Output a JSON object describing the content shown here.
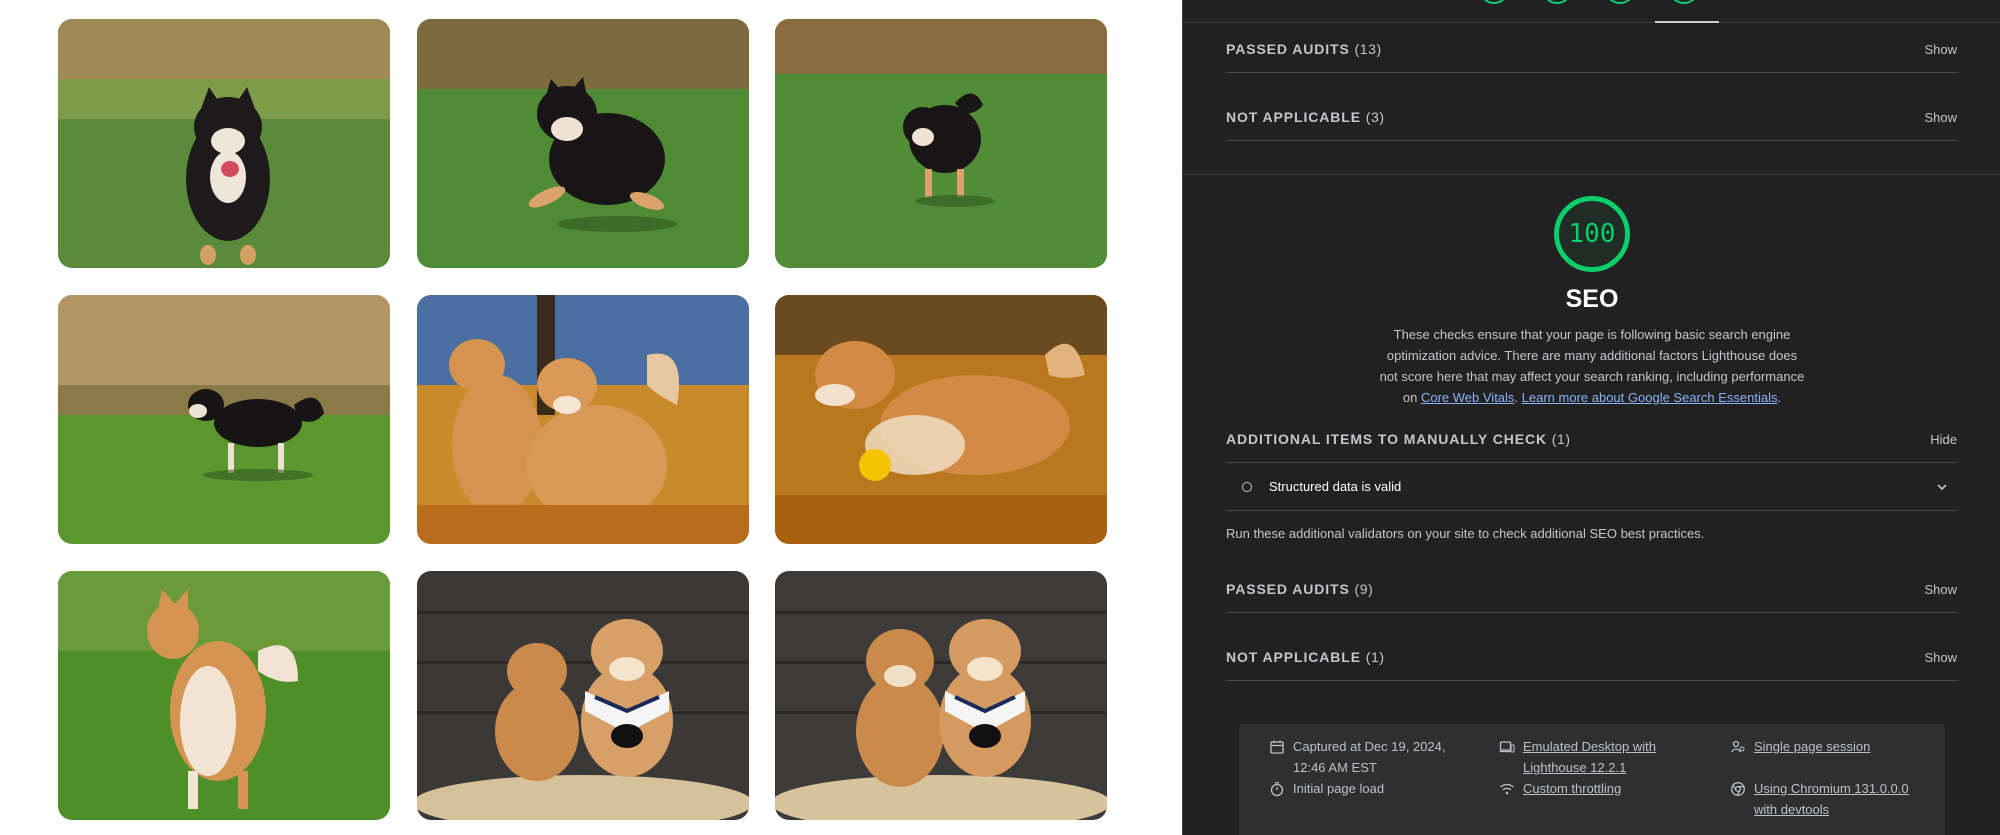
{
  "gallery": {
    "photos": [
      {
        "alt": "black shiba running"
      },
      {
        "alt": "black shiba jumping"
      },
      {
        "alt": "black shiba trotting"
      },
      {
        "alt": "black shiba standing"
      },
      {
        "alt": "two red shibas in leaves"
      },
      {
        "alt": "red shiba walking in leaves"
      },
      {
        "alt": "cream shiba standing"
      },
      {
        "alt": "two shiba puppies"
      },
      {
        "alt": "two shiba puppies with bandana"
      }
    ]
  },
  "panel": {
    "upper_groups": [
      {
        "title": "PASSED AUDITS",
        "count": "(13)",
        "toggle": "Show"
      },
      {
        "title": "NOT APPLICABLE",
        "count": "(3)",
        "toggle": "Show"
      }
    ],
    "seo": {
      "score": "100",
      "title": "SEO",
      "description_before": "These checks ensure that your page is following basic search engine optimization advice. There are many additional factors Lighthouse does not score here that may affect your search ranking, including performance on ",
      "link_core_web_vitals": "Core Web Vitals",
      "description_mid": ". ",
      "link_learn_more": "Learn more about Google Search Essentials",
      "description_after": "."
    },
    "manual_group": {
      "title": "ADDITIONAL ITEMS TO MANUALLY CHECK",
      "count": "(1)",
      "toggle": "Hide"
    },
    "manual_audit": {
      "title": "Structured data is valid"
    },
    "validators_note": "Run these additional validators on your site to check additional SEO best practices.",
    "lower_groups": [
      {
        "title": "PASSED AUDITS",
        "count": "(9)",
        "toggle": "Show"
      },
      {
        "title": "NOT APPLICABLE",
        "count": "(1)",
        "toggle": "Show"
      }
    ],
    "footer": {
      "captured": "Captured at Dec 19, 2024, 12:46 AM EST",
      "initial_load": "Initial page load",
      "emulated": "Emulated Desktop with Lighthouse 12.2.1",
      "throttling": "Custom throttling",
      "session": "Single page session",
      "chromium": "Using Chromium 131.0.0.0 with devtools"
    },
    "colors": {
      "pass": "#0cce6b",
      "link": "#8ab4f8",
      "background": "#212121"
    },
    "icons": [
      "calendar-icon",
      "timer-icon",
      "device-icon",
      "wifi-icon",
      "person-icon",
      "chrome-icon",
      "chevron-down-icon"
    ]
  }
}
